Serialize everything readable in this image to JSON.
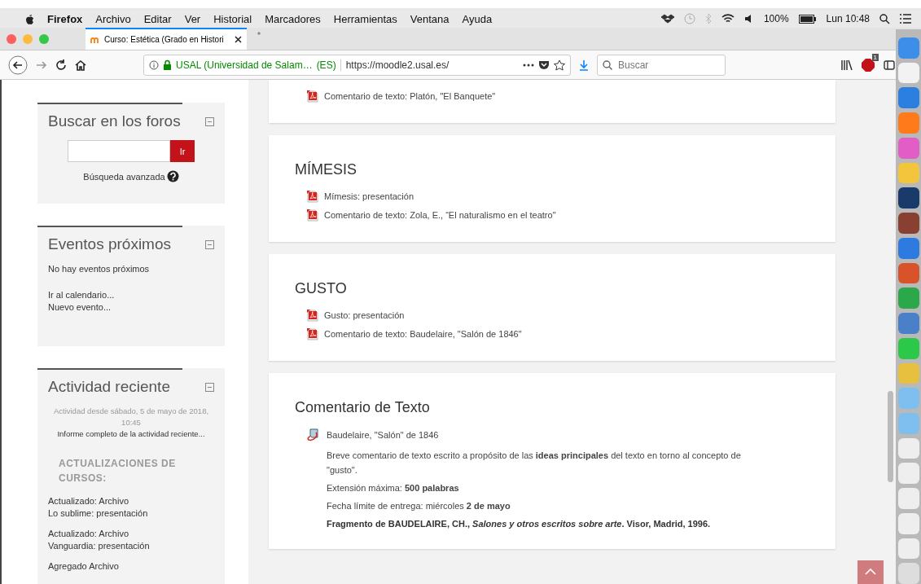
{
  "menubar": {
    "app": "Firefox",
    "items": [
      "Archivo",
      "Editar",
      "Ver",
      "Historial",
      "Marcadores",
      "Herramientas",
      "Ventana",
      "Ayuda"
    ],
    "battery": "100%",
    "clock": "Lun 10:48"
  },
  "tabs": [
    {
      "title": "Curso: Estética (Grado en Histori",
      "selected": true
    }
  ],
  "toolbar": {
    "site": "USAL (Universidad de Salam…",
    "country": "(ES)",
    "url": "https://moodle2.usal.es/",
    "search_placeholder": "Buscar",
    "adblock_count": "1"
  },
  "sidebar": [
    {
      "kind": "search",
      "title": "Buscar en los foros",
      "button": "Ir",
      "link": "Búsqueda avanzada"
    },
    {
      "kind": "events",
      "title": "Eventos próximos",
      "message": "No hay eventos próximos",
      "links": [
        "Ir al calendario...",
        "Nuevo evento..."
      ]
    },
    {
      "kind": "recent",
      "title": "Actividad reciente",
      "since": "Actividad desde sábado, 5 de mayo de 2018, 10:45",
      "report": "Informe completo de la actividad reciente...",
      "heading": "ACTUALIZACIONES DE CURSOS:",
      "updates": [
        {
          "action": "Actualizado: Archivo",
          "item": "Lo sublime: presentación"
        },
        {
          "action": "Actualizado: Archivo",
          "item": "Vanguardia: presentación"
        },
        {
          "action": "Agregado Archivo"
        }
      ]
    }
  ],
  "sections": [
    {
      "items": [
        {
          "kind": "pdf",
          "text": "Comentario de texto: Platón, \"El Banquete\""
        }
      ]
    },
    {
      "title": "MÍMESIS",
      "items": [
        {
          "kind": "pdf",
          "text": "Mímesis: presentación"
        },
        {
          "kind": "pdf",
          "text": "Comentario de texto: Zola, E., “El naturalismo en el teatro\""
        }
      ]
    },
    {
      "title": "GUSTO",
      "items": [
        {
          "kind": "pdf",
          "text": "Gusto: presentación"
        },
        {
          "kind": "pdf",
          "text": "Comentario de texto: Baudelaire, \"Salón de 1846\""
        }
      ]
    },
    {
      "title": "Comentario de Texto",
      "items": [
        {
          "kind": "assignment",
          "text": "Baudelaire, \"Salón\" de 1846",
          "paragraphs": [
            {
              "text": "Breve comentario de texto escrito a propósito de las **ideas principales** del texto en torno al concepto de \"gusto\".",
              "bold": false
            },
            {
              "text": "Extensión máxima: **500 palabras**",
              "bold": false
            },
            {
              "text": "Fecha límite de entrega: miércoles **2 de mayo**",
              "bold": false
            },
            {
              "text": "Fragmento de BAUDELAIRE, CH., *Salones y otros escritos sobre arte*. Visor, Madrid, 1996.",
              "bold": true
            }
          ]
        }
      ]
    }
  ]
}
